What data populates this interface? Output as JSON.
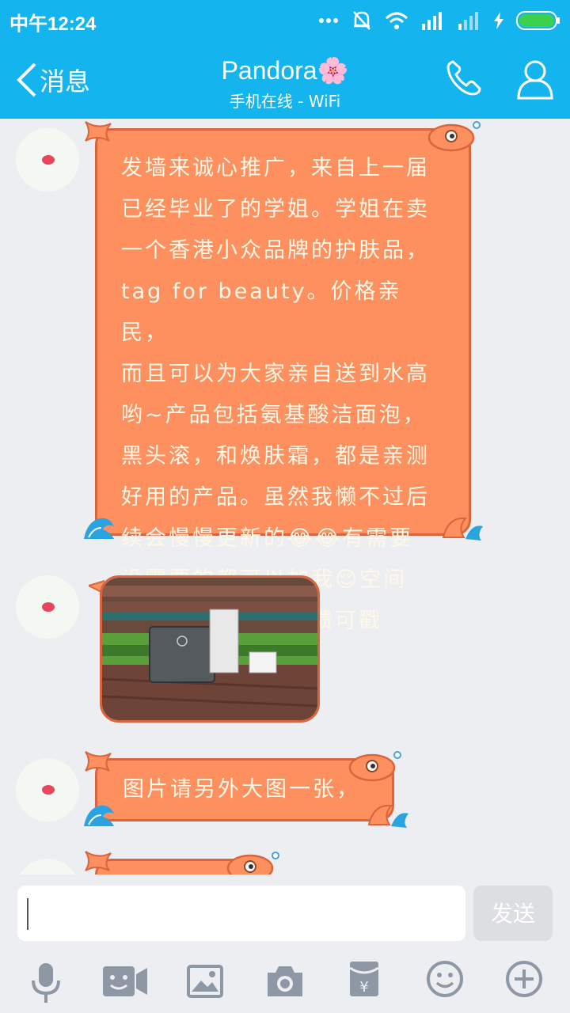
{
  "status": {
    "time": "中午12:24"
  },
  "header": {
    "back_label": "消息",
    "title": "Pandora🌸",
    "subtitle": "手机在线 - WiFi"
  },
  "messages": [
    {
      "type": "text",
      "lines": [
        "发墙来诚心推广，来自上一届",
        "已经毕业了的学姐。学姐在卖",
        "一个香港小众品牌的护肤品，",
        "tag for beauty。价格亲民，",
        "而且可以为大家亲自送到水高",
        "哟~产品包括氨基酸洁面泡，",
        "黑头滚，和焕肤霜，都是亲测",
        "好用的产品。虽然我懒不过后",
        "续会慢慢更新的😂😂有需要",
        "没需要的都可以加我😌空间",
        "里有很多介绍和反馈可戳"
      ]
    },
    {
      "type": "image"
    },
    {
      "type": "text",
      "text": "图片请另外大图一张，"
    }
  ],
  "input": {
    "placeholder": "",
    "send_label": "发送"
  },
  "toolbar": [
    "microphone-icon",
    "video-icon",
    "image-icon",
    "camera-icon",
    "red-packet-icon",
    "emoji-icon",
    "plus-icon"
  ],
  "colors": {
    "header": "#14b4ee",
    "bubble": "#fe8f5e",
    "bubble_border": "#d9653d"
  }
}
